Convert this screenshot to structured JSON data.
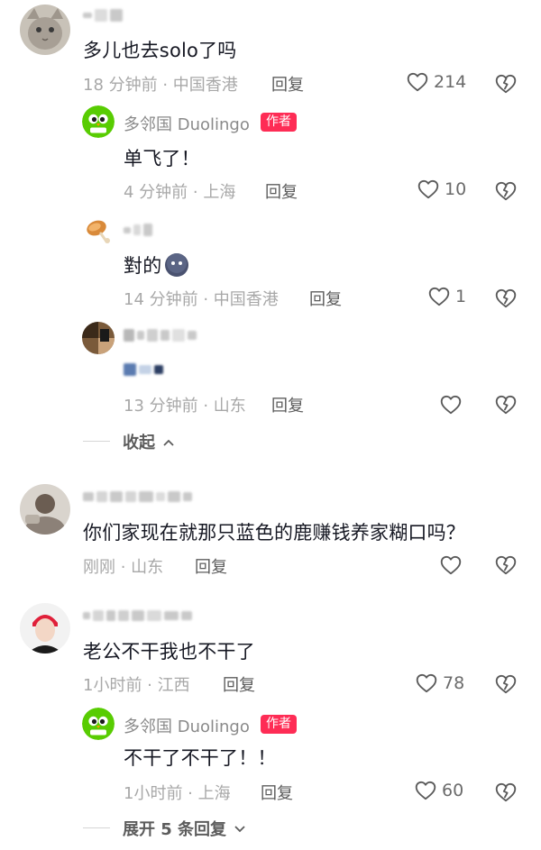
{
  "colors": {
    "badge": "#fe2c55",
    "duo_green": "#58cc02"
  },
  "comments": [
    {
      "text": "多儿也去solo了吗",
      "time": "18 分钟前 · 中国香港",
      "reply": "回复",
      "likes": "214",
      "replies": [
        {
          "author": "多邻国 Duolingo",
          "badge": "作者",
          "text": "单飞了！",
          "time": "4 分钟前 · 上海",
          "reply": "回复",
          "likes": "10"
        },
        {
          "text": "對的",
          "time": "14 分钟前 · 中国香港",
          "reply": "回复",
          "likes": "1"
        },
        {
          "time": "13 分钟前 · 山东",
          "reply": "回复"
        }
      ],
      "collapse": "收起"
    },
    {
      "text": "你们家现在就那只蓝色的鹿赚钱养家糊口吗？",
      "time": "刚刚 · 山东",
      "reply": "回复"
    },
    {
      "text": "老公不干我也不干了",
      "time": "1小时前 · 江西",
      "reply": "回复",
      "likes": "78",
      "replies": [
        {
          "author": "多邻国 Duolingo",
          "badge": "作者",
          "text": "不干了不干了！！",
          "time": "1小时前 · 上海",
          "reply": "回复",
          "likes": "60"
        }
      ],
      "expand": "展开 5 条回复"
    }
  ]
}
